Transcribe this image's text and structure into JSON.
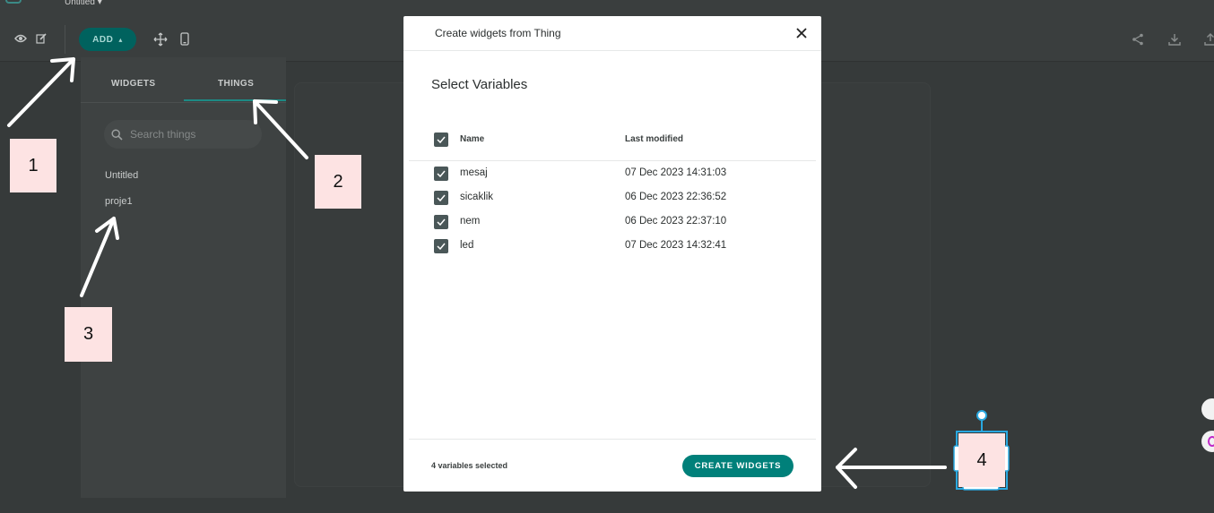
{
  "app": {
    "title": "Untitled",
    "title_caret": "▾"
  },
  "toolbar": {
    "add_label": "ADD",
    "add_caret": "▴"
  },
  "panel": {
    "tabs": [
      {
        "label": "WIDGETS",
        "active": false
      },
      {
        "label": "THINGS",
        "active": true
      }
    ],
    "search_placeholder": "Search things",
    "things": [
      "Untitled",
      "proje1"
    ]
  },
  "modal": {
    "title": "Create widgets from Thing",
    "subtitle": "Select Variables",
    "columns": {
      "name": "Name",
      "last_modified": "Last modified"
    },
    "rows": [
      {
        "name": "mesaj",
        "date": "07 Dec 2023 14:31:03",
        "checked": true
      },
      {
        "name": "sicaklik",
        "date": "06 Dec 2023 22:36:52",
        "checked": true
      },
      {
        "name": "nem",
        "date": "06 Dec 2023 22:37:10",
        "checked": true
      },
      {
        "name": "led",
        "date": "07 Dec 2023 14:32:41",
        "checked": true
      }
    ],
    "selected_count_text": "4 variables selected",
    "create_button": "CREATE WIDGETS"
  },
  "annotations": {
    "badges": [
      "1",
      "2",
      "3",
      "4"
    ]
  },
  "colors": {
    "accent": "#00807a",
    "add_button": "#00625e",
    "checkbox": "#4a5758",
    "badge": "#fde3e3",
    "background": "#363a3a"
  },
  "icons": [
    "eye-icon",
    "edit-icon",
    "move-icon",
    "mobile-icon",
    "share-icon",
    "download-icon",
    "search-icon",
    "close-icon",
    "check-icon"
  ]
}
